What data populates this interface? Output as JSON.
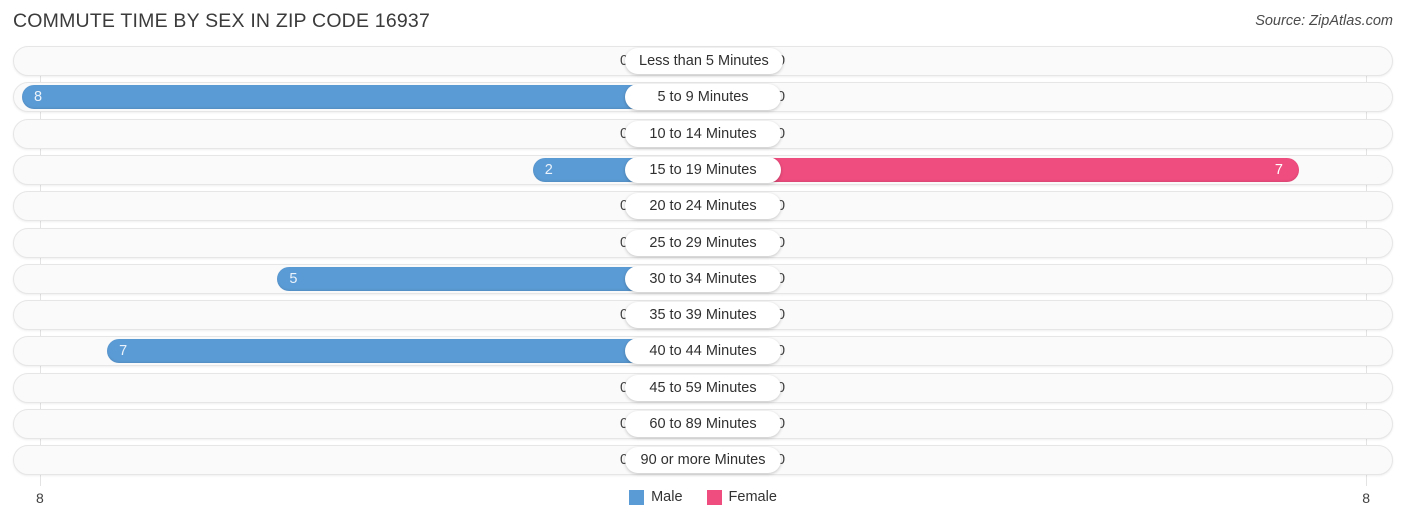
{
  "header": {
    "title": "COMMUTE TIME BY SEX IN ZIP CODE 16937",
    "source": "Source: ZipAtlas.com"
  },
  "legend": {
    "male_label": "Male",
    "female_label": "Female",
    "male_color": "#5b9bd5",
    "female_color": "#ef4d7f"
  },
  "axis": {
    "left_end": "8",
    "right_end": "8"
  },
  "colors": {
    "male_strong": "#5b9bd5",
    "male_light": "#aecbf0",
    "female_strong": "#ef4d7f",
    "female_light": "#f9a3c0",
    "track": "#fafafa",
    "gridline": "#e3e3e3"
  },
  "chart_data": {
    "type": "bar",
    "title": "COMMUTE TIME BY SEX IN ZIP CODE 16937",
    "subtitle": "Source: ZipAtlas.com",
    "orientation": "horizontal-diverging",
    "xlabel": "",
    "ylabel": "",
    "xlim": [
      8,
      8
    ],
    "grid": true,
    "legend_position": "bottom-center",
    "categories": [
      "Less than 5 Minutes",
      "5 to 9 Minutes",
      "10 to 14 Minutes",
      "15 to 19 Minutes",
      "20 to 24 Minutes",
      "25 to 29 Minutes",
      "30 to 34 Minutes",
      "35 to 39 Minutes",
      "40 to 44 Minutes",
      "45 to 59 Minutes",
      "60 to 89 Minutes",
      "90 or more Minutes"
    ],
    "series": [
      {
        "name": "Male",
        "values": [
          0,
          8,
          0,
          2,
          0,
          0,
          5,
          0,
          7,
          0,
          0,
          0
        ]
      },
      {
        "name": "Female",
        "values": [
          0,
          0,
          0,
          7,
          0,
          0,
          0,
          0,
          0,
          0,
          0,
          0
        ]
      }
    ]
  },
  "rows": [
    {
      "label": "Less than 5 Minutes",
      "male": "0",
      "female": "0"
    },
    {
      "label": "5 to 9 Minutes",
      "male": "8",
      "female": "0"
    },
    {
      "label": "10 to 14 Minutes",
      "male": "0",
      "female": "0"
    },
    {
      "label": "15 to 19 Minutes",
      "male": "2",
      "female": "7"
    },
    {
      "label": "20 to 24 Minutes",
      "male": "0",
      "female": "0"
    },
    {
      "label": "25 to 29 Minutes",
      "male": "0",
      "female": "0"
    },
    {
      "label": "30 to 34 Minutes",
      "male": "5",
      "female": "0"
    },
    {
      "label": "35 to 39 Minutes",
      "male": "0",
      "female": "0"
    },
    {
      "label": "40 to 44 Minutes",
      "male": "7",
      "female": "0"
    },
    {
      "label": "45 to 59 Minutes",
      "male": "0",
      "female": "0"
    },
    {
      "label": "60 to 89 Minutes",
      "male": "0",
      "female": "0"
    },
    {
      "label": "90 or more Minutes",
      "male": "0",
      "female": "0"
    }
  ]
}
